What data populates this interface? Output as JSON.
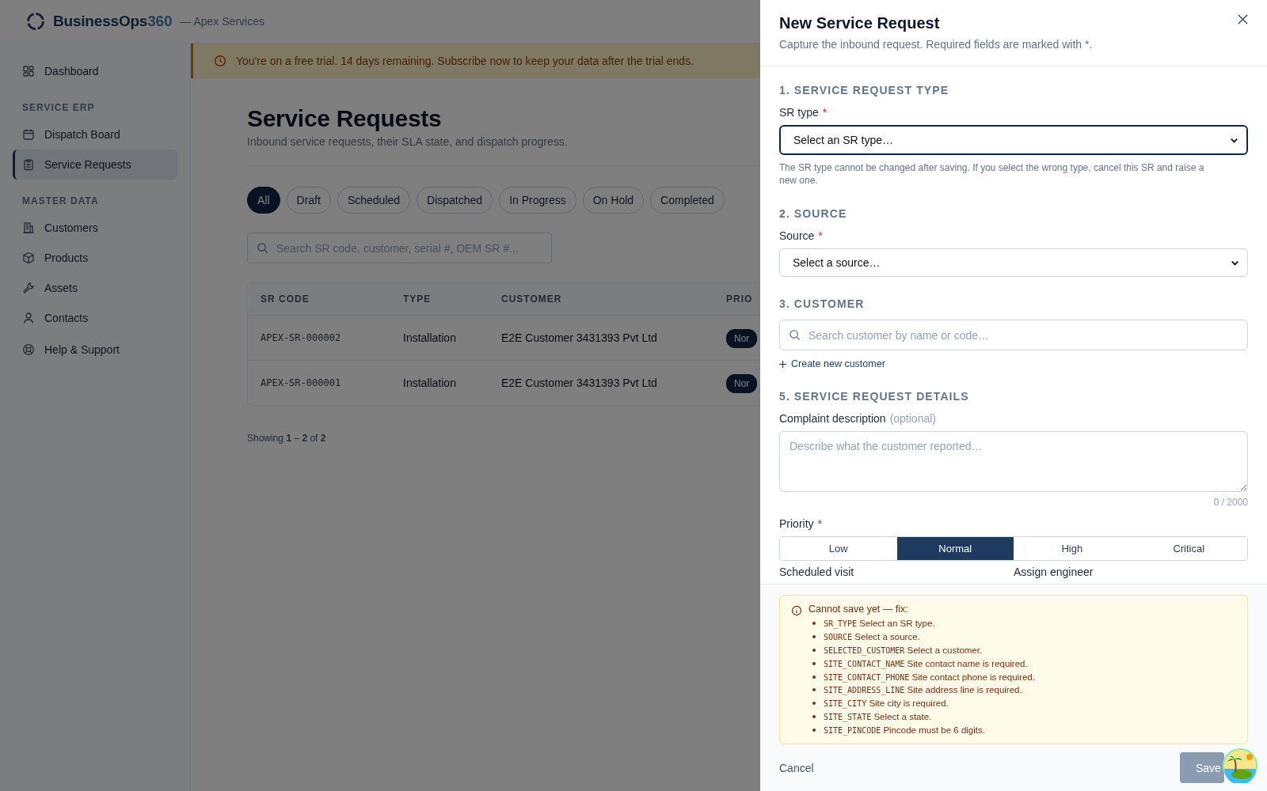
{
  "app": {
    "brand": "BusinessOps",
    "brand_suffix": "360",
    "org": "— Apex Services"
  },
  "sidebar": {
    "groups": [
      {
        "items": [
          {
            "label": "Dashboard",
            "selected": false
          }
        ]
      },
      {
        "heading": "SERVICE ERP",
        "items": [
          {
            "label": "Dispatch Board",
            "selected": false
          },
          {
            "label": "Service Requests",
            "selected": true
          }
        ]
      },
      {
        "heading": "MASTER DATA",
        "items": [
          {
            "label": "Customers",
            "selected": false
          },
          {
            "label": "Products",
            "selected": false
          },
          {
            "label": "Assets",
            "selected": false
          },
          {
            "label": "Contacts",
            "selected": false
          }
        ]
      }
    ],
    "footer_items": [
      {
        "label": "Help & Support",
        "selected": false
      }
    ]
  },
  "banner": {
    "text": "You're on a free trial. 14 days remaining. Subscribe now to keep your data after the trial ends."
  },
  "page": {
    "title": "Service Requests",
    "subtitle": "Inbound service requests, their SLA state, and dispatch progress.",
    "filters": [
      {
        "label": "All",
        "selected": true
      },
      {
        "label": "Draft",
        "selected": false
      },
      {
        "label": "Scheduled",
        "selected": false
      },
      {
        "label": "Dispatched",
        "selected": false
      },
      {
        "label": "In Progress",
        "selected": false
      },
      {
        "label": "On Hold",
        "selected": false
      },
      {
        "label": "Completed",
        "selected": false
      }
    ],
    "search": {
      "placeholder": "Search SR code, customer, serial #, OEM SR #..."
    },
    "table": {
      "columns": [
        "SR CODE",
        "TYPE",
        "CUSTOMER",
        "PRIO"
      ],
      "rows": [
        {
          "sr_code": "APEX-SR-000002",
          "type": "Installation",
          "customer": "E2E Customer 3431393 Pvt Ltd",
          "priority": "Nor"
        },
        {
          "sr_code": "APEX-SR-000001",
          "type": "Installation",
          "customer": "E2E Customer 3431393 Pvt Ltd",
          "priority": "Nor"
        }
      ]
    },
    "pagination": "Showing **1** – **2** of **2**"
  },
  "drawer": {
    "title": "New Service Request",
    "subtitle": "Capture the inbound request. Required fields are marked with *.",
    "sections": [
      {
        "heading": "1. SERVICE REQUEST TYPE",
        "fields": [
          {
            "kind": "select",
            "label": "SR type",
            "required_mark": "*",
            "value": "Select an SR type…",
            "focused": true,
            "hint": "The SR type cannot be changed after saving. If you select the wrong type, cancel this SR and raise a new one."
          }
        ]
      },
      {
        "heading": "2. SOURCE",
        "fields": [
          {
            "kind": "select",
            "label": "Source",
            "required_mark": "*",
            "value": "Select a source…",
            "focused": false
          }
        ]
      },
      {
        "heading": "3. CUSTOMER",
        "fields": [
          {
            "kind": "search",
            "placeholder": "Search customer by name or code…",
            "link": "Create new customer"
          }
        ]
      },
      {
        "heading": "5. SERVICE REQUEST DETAILS",
        "fields": [
          {
            "kind": "textarea",
            "label": "Complaint description",
            "note": "(optional)",
            "placeholder": "Describe what the customer reported…",
            "counter": "0 / 2000"
          },
          {
            "kind": "segmented",
            "label": "Priority",
            "required_mark": "*",
            "options": [
              {
                "label": "Low",
                "selected": false
              },
              {
                "label": "Normal",
                "selected": true
              },
              {
                "label": "High",
                "selected": false
              },
              {
                "label": "Critical",
                "selected": false
              }
            ]
          },
          {
            "kind": "pair",
            "labels": [
              "Scheduled visit",
              "Assign engineer"
            ]
          }
        ]
      }
    ],
    "errors": {
      "title": "Cannot save yet — fix:",
      "items": [
        {
          "code": "SR_TYPE",
          "message": "Select an SR type."
        },
        {
          "code": "SOURCE",
          "message": "Select a source."
        },
        {
          "code": "SELECTED_CUSTOMER",
          "message": "Select a customer."
        },
        {
          "code": "SITE_CONTACT_NAME",
          "message": "Site contact name is required."
        },
        {
          "code": "SITE_CONTACT_PHONE",
          "message": "Site contact phone is required."
        },
        {
          "code": "SITE_ADDRESS_LINE",
          "message": "Site address line is required."
        },
        {
          "code": "SITE_CITY",
          "message": "Site city is required."
        },
        {
          "code": "SITE_STATE",
          "message": "Select a state."
        },
        {
          "code": "SITE_PINCODE",
          "message": "Pincode must be 6 digits."
        }
      ]
    },
    "cancel": "Cancel",
    "save": {
      "label": "Save",
      "disabled": true
    }
  }
}
